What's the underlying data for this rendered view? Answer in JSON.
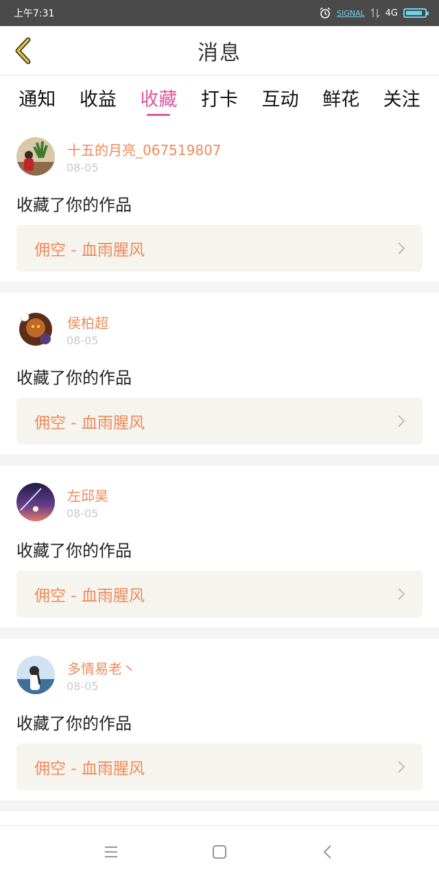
{
  "status_bar": {
    "time": "上午7:31",
    "signal_label": "SIGNAL",
    "network": "4G",
    "battery_level": 0.9
  },
  "header": {
    "title": "消息"
  },
  "tabs": [
    {
      "label": "通知",
      "active": false
    },
    {
      "label": "收益",
      "active": false
    },
    {
      "label": "收藏",
      "active": true
    },
    {
      "label": "打卡",
      "active": false
    },
    {
      "label": "互动",
      "active": false
    },
    {
      "label": "鲜花",
      "active": false
    },
    {
      "label": "关注",
      "active": false
    }
  ],
  "messages": [
    {
      "user": "十五的月亮_067519807",
      "date": "08-05",
      "action": "收藏了你的作品",
      "work": "佣空 - 血雨腥风"
    },
    {
      "user": "侯柏超",
      "date": "08-05",
      "action": "收藏了你的作品",
      "work": "佣空 - 血雨腥风"
    },
    {
      "user": "左邱昊",
      "date": "08-05",
      "action": "收藏了你的作品",
      "work": "佣空 - 血雨腥风"
    },
    {
      "user": "多情易老丶",
      "date": "08-05",
      "action": "收藏了你的作品",
      "work": "佣空 - 血雨腥风"
    }
  ],
  "colors": {
    "accent": "#e0559b",
    "username": "#ef8a5a",
    "back_icon": "#e3c530"
  }
}
